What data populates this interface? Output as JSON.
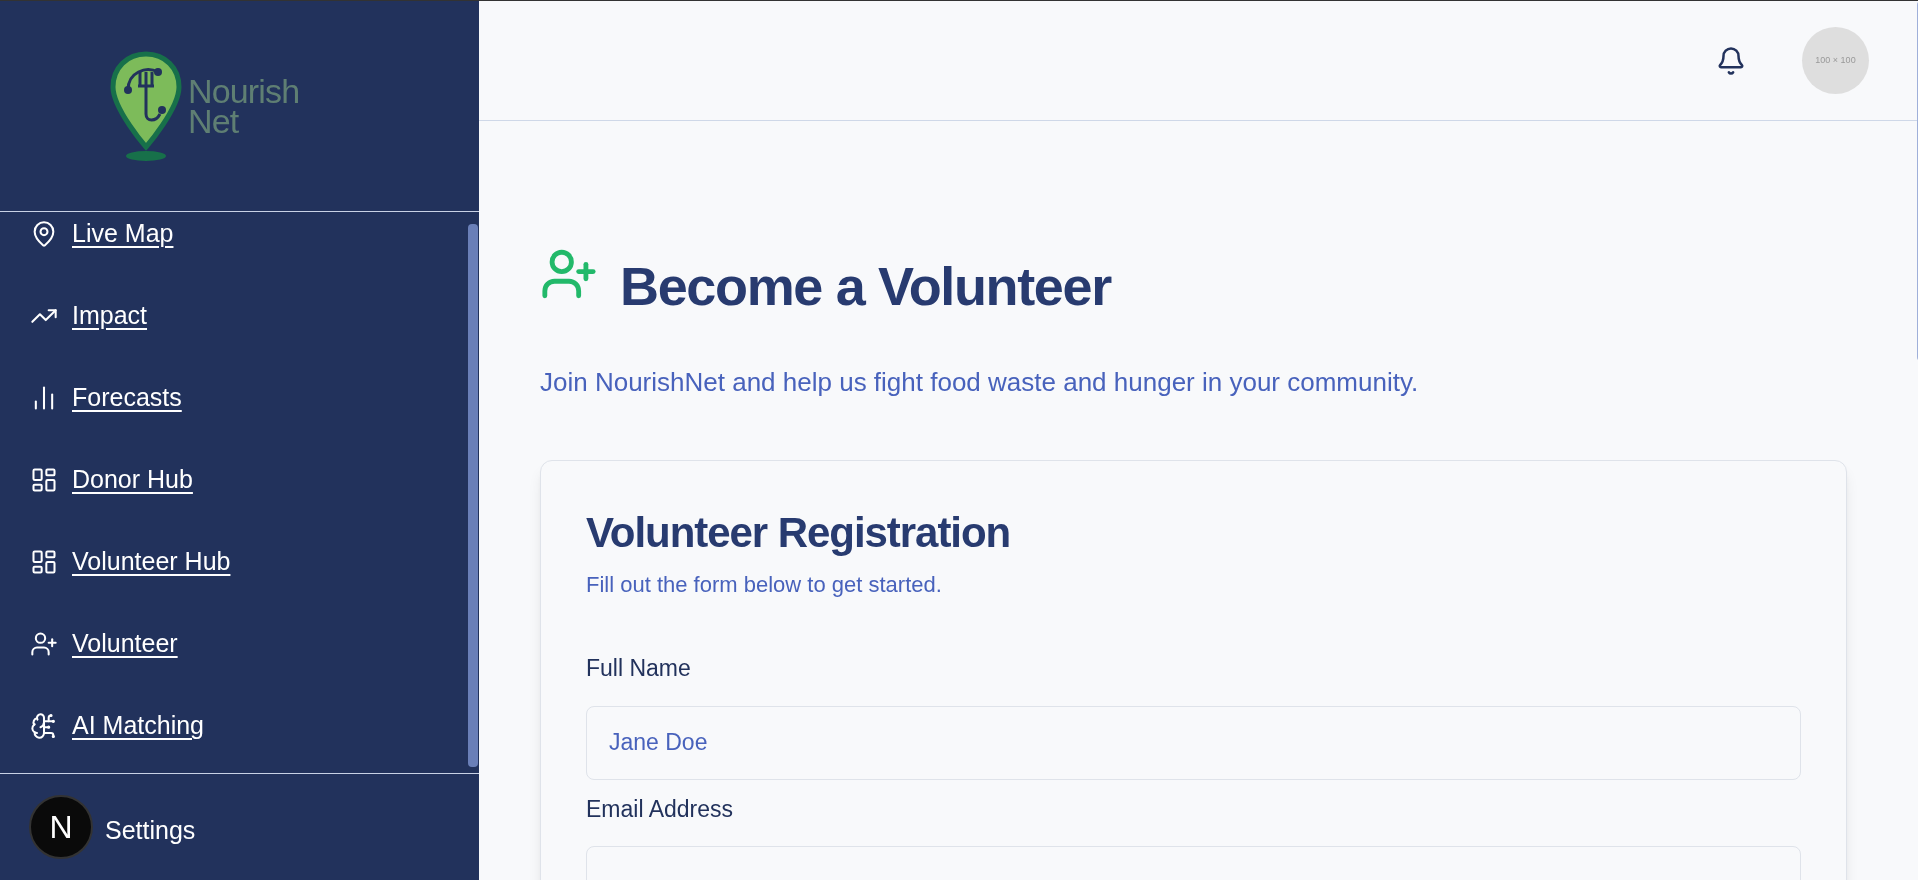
{
  "sidebar": {
    "logo": {
      "line_1": "Nourish",
      "line_2": "Net"
    },
    "items": [
      {
        "kind": "pin",
        "label": "Live Map"
      },
      {
        "kind": "trend",
        "label": "Impact"
      },
      {
        "kind": "bars",
        "label": "Forecasts"
      },
      {
        "kind": "grid",
        "label": "Donor Hub"
      },
      {
        "kind": "grid",
        "label": "Volunteer Hub"
      },
      {
        "kind": "user-plus",
        "label": "Volunteer"
      },
      {
        "kind": "brain",
        "label": "AI Matching"
      }
    ],
    "footer": {
      "badge": "N",
      "label": "Settings"
    }
  },
  "header": {
    "avatar_label": "100 × 100"
  },
  "page": {
    "title": "Become a Volunteer",
    "subtitle": "Join NourishNet and help us fight food waste and hunger in your community."
  },
  "form": {
    "title": "Volunteer Registration",
    "subtitle": "Fill out the form below to get started.",
    "fields": [
      {
        "label": "Full Name",
        "placeholder": "Jane Doe"
      },
      {
        "label": "Email Address"
      }
    ]
  }
}
